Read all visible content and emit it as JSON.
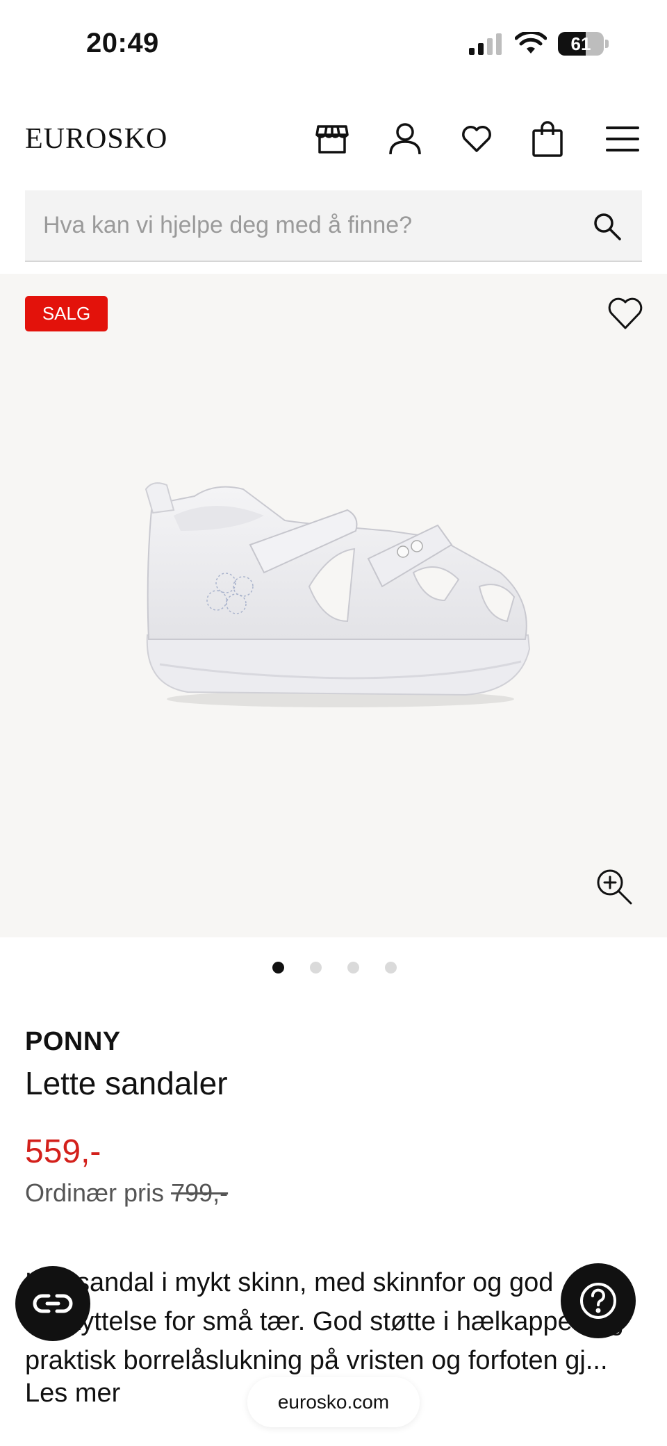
{
  "status_bar": {
    "time": "20:49",
    "battery_level": "61",
    "battery_fraction": 0.61,
    "icons": [
      "signal-icon",
      "wifi-icon",
      "battery-icon"
    ]
  },
  "header": {
    "logo": "EUROSKO",
    "icons": [
      "store-icon",
      "account-icon",
      "wishlist-icon",
      "cart-icon",
      "menu-icon"
    ]
  },
  "search": {
    "placeholder": "Hva kan vi hjelpe deg med å finne?",
    "value": ""
  },
  "gallery": {
    "badge": "SALG",
    "image_count": 4,
    "active_index": 0
  },
  "product": {
    "brand": "PONNY",
    "name": "Lette sandaler",
    "price": "559,-",
    "original_label": "Ordinær pris",
    "original_price": "799,-",
    "description": "Lett sandal i mykt skinn, med skinnfor og god beskyttelse for små tær. God støtte i hælkappen og praktisk borrelåslukning på vristen og forfoten gj...",
    "read_more": "Les mer"
  },
  "browser": {
    "url": "eurosko.com"
  },
  "colors": {
    "sale_red": "#e3120b",
    "price_red": "#d3201b",
    "gallery_bg": "#f7f6f4",
    "search_bg": "#f3f3f3"
  }
}
